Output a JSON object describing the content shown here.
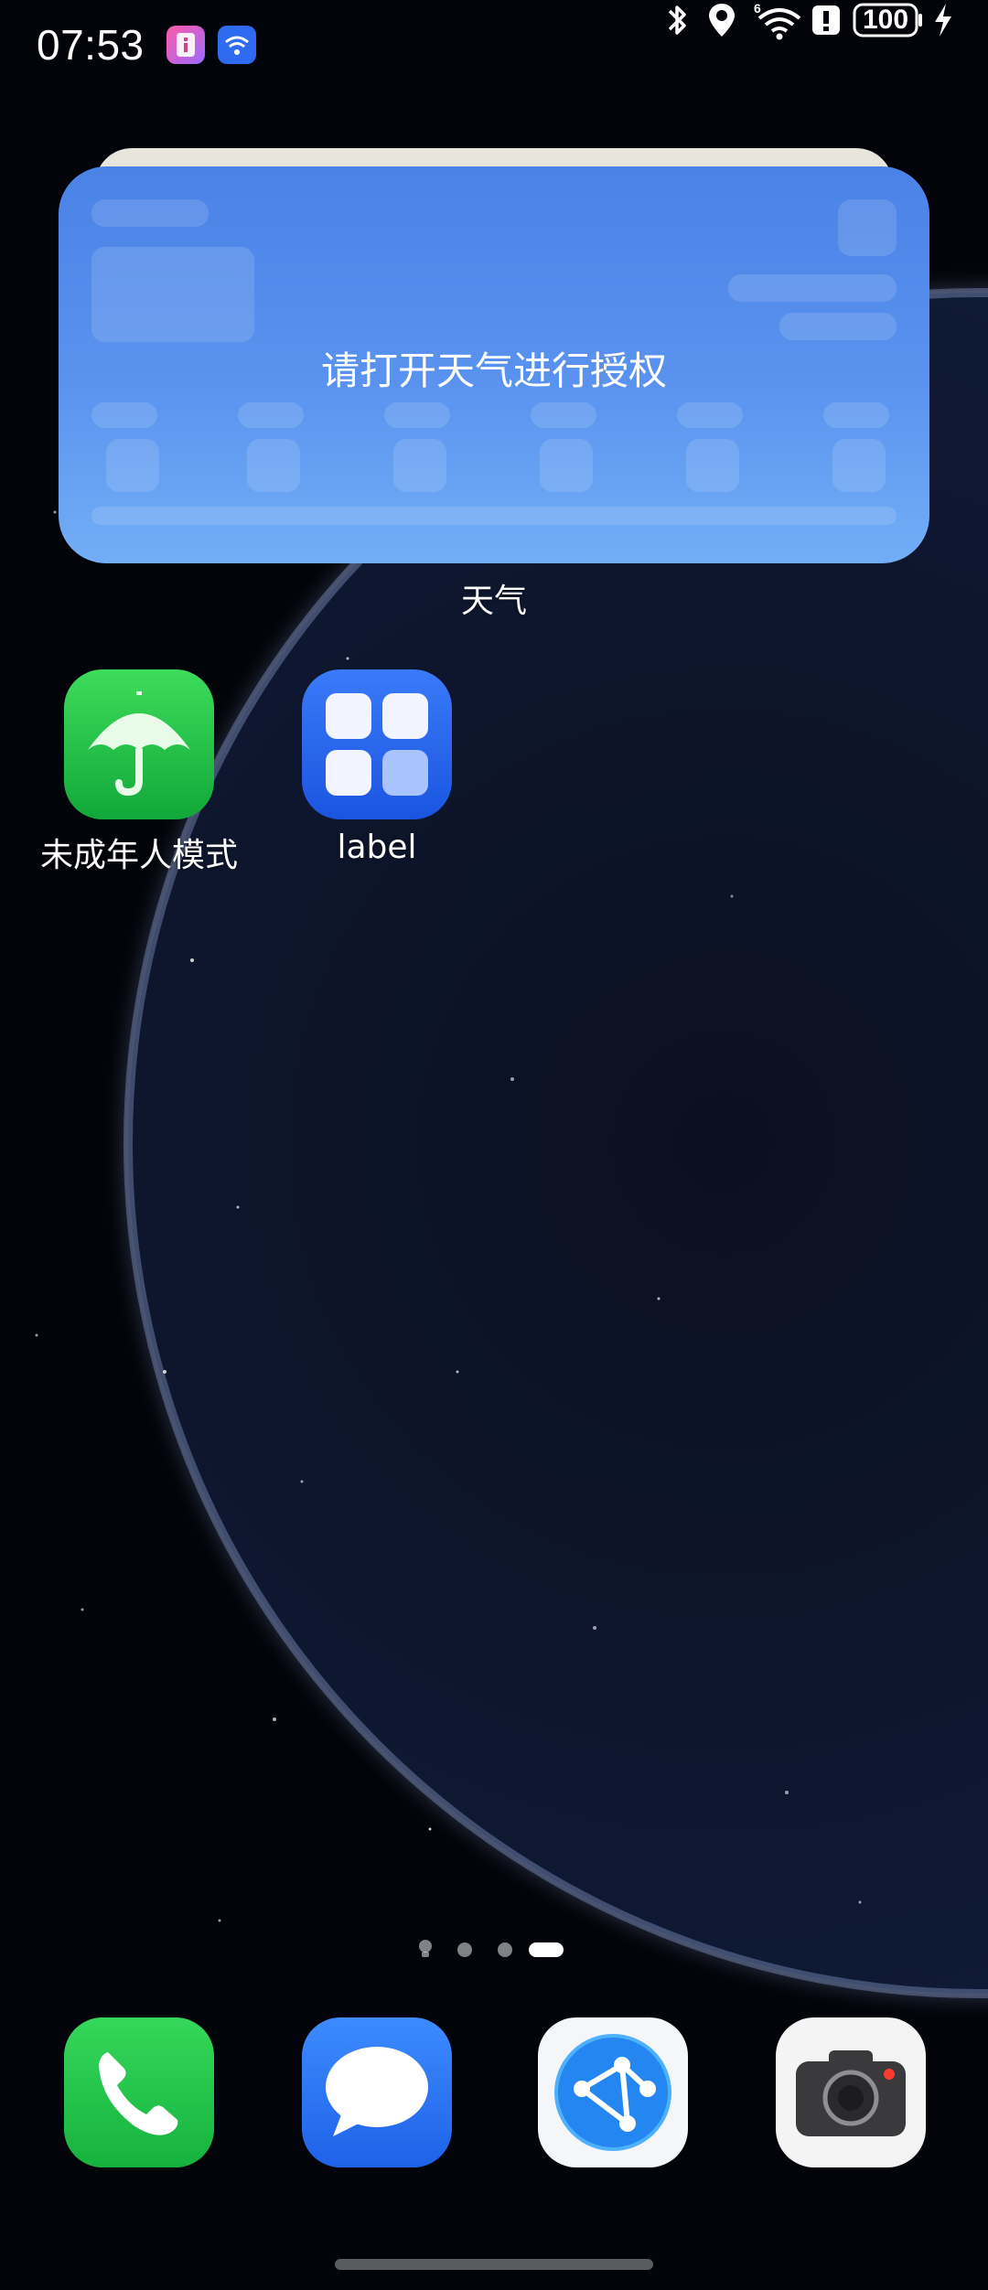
{
  "status_bar": {
    "time": "07:53",
    "battery": "100",
    "icons": [
      "notification-app-icon",
      "wifi-app-icon",
      "bluetooth-icon",
      "location-icon",
      "wifi-6-icon",
      "alert-icon",
      "battery-icon",
      "charging-icon"
    ]
  },
  "weather_widget": {
    "message": "请打开天气进行授权",
    "label": "天气"
  },
  "apps": [
    {
      "label": "未成年人模式",
      "icon": "umbrella-icon"
    },
    {
      "label": "label",
      "icon": "grid-icon"
    }
  ],
  "page_indicator": {
    "pages": 4,
    "active": 4
  },
  "dock": [
    {
      "name": "phone",
      "icon": "phone-icon"
    },
    {
      "name": "messages",
      "icon": "message-icon"
    },
    {
      "name": "browser",
      "icon": "browser-icon"
    },
    {
      "name": "camera",
      "icon": "camera-icon"
    }
  ],
  "colors": {
    "widget_top": "#4a82e6",
    "widget_bottom": "#72aef6",
    "phone_green": "#1fc94a",
    "message_blue": "#2e7bf6"
  }
}
